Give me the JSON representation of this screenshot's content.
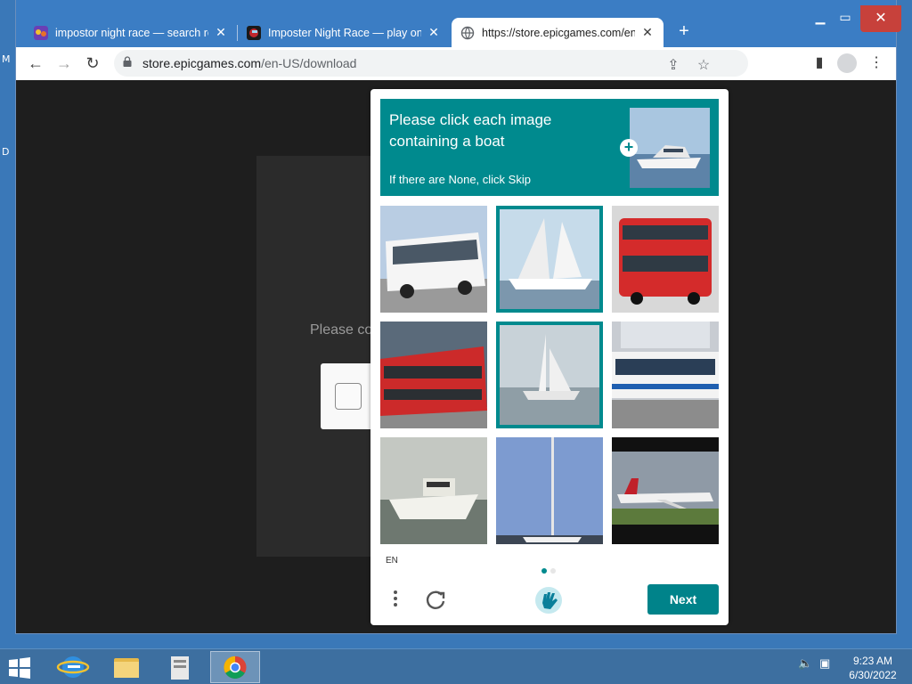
{
  "browser": {
    "tabs": [
      {
        "title": "impostor night race — search res",
        "active": false
      },
      {
        "title": "Imposter Night Race — play onli",
        "active": false
      },
      {
        "title": "https://store.epicgames.com/en-",
        "active": true
      }
    ],
    "new_tab_label": "+",
    "url_host": "store.epicgames.com",
    "url_path": "/en-US/download"
  },
  "page": {
    "partial_text": "Please co"
  },
  "captcha": {
    "prompt_line1": "Please click each image containing a boat",
    "prompt_line2": "If there are None, click Skip",
    "plus_icon": "+",
    "cells": [
      {
        "subject": "white coach bus",
        "selected": false
      },
      {
        "subject": "sailboat",
        "selected": true
      },
      {
        "subject": "red double-decker bus",
        "selected": false
      },
      {
        "subject": "red double-decker bus",
        "selected": false
      },
      {
        "subject": "sailboat",
        "selected": true
      },
      {
        "subject": "city bus",
        "selected": false
      },
      {
        "subject": "motor boat",
        "selected": false
      },
      {
        "subject": "sailboat mast",
        "selected": false
      },
      {
        "subject": "airplane",
        "selected": false
      }
    ],
    "language": "EN",
    "page_dots": 2,
    "next_label": "Next",
    "accent_color": "#008a8e"
  },
  "taskbar": {
    "time": "9:23 AM",
    "date": "6/30/2022"
  },
  "desktop": {
    "edge_letters": [
      "M",
      "D"
    ]
  }
}
